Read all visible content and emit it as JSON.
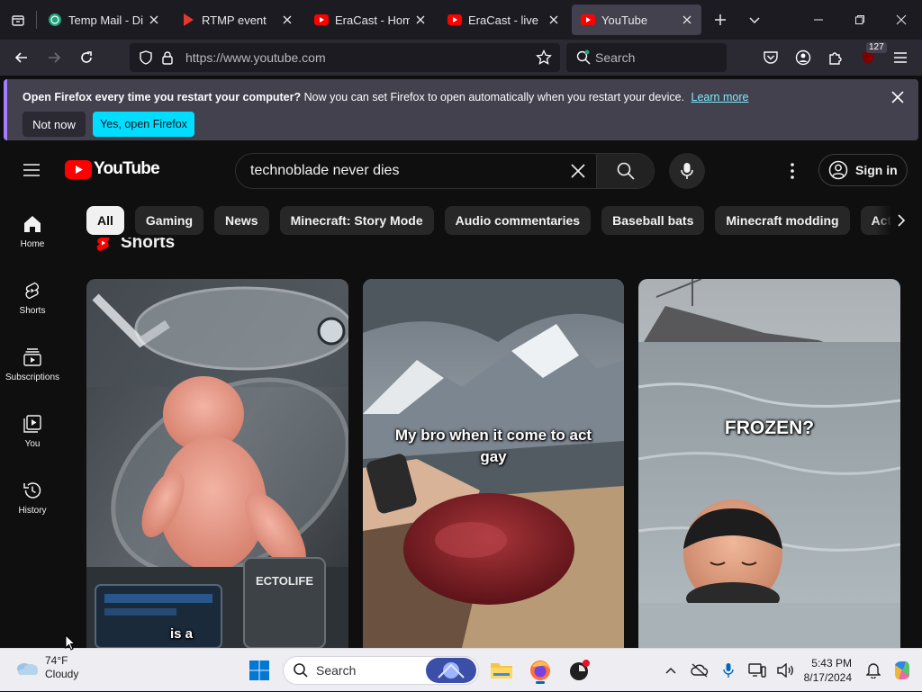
{
  "browser": {
    "tabs": [
      {
        "title": "Temp Mail - Disposable",
        "favicon": "tempmail-icon",
        "active": false
      },
      {
        "title": "RTMP event",
        "favicon": "play-triangle-icon",
        "active": false
      },
      {
        "title": "EraCast - Home",
        "favicon": "youtube-icon",
        "active": false
      },
      {
        "title": "EraCast - live",
        "favicon": "youtube-icon",
        "active": false
      },
      {
        "title": "YouTube",
        "favicon": "youtube-icon",
        "active": true
      }
    ],
    "url": "https://www.youtube.com",
    "search_placeholder": "Search",
    "extension_badge": "127",
    "colors": {
      "chrome_dark": "#1c1b22",
      "toolbar": "#2b2a33",
      "active_tab": "#42414d",
      "accent": "#00ddff"
    }
  },
  "notification": {
    "bold": "Open Firefox every time you restart your computer?",
    "text": "Now you can set Firefox to open automatically when you restart your device.",
    "link": "Learn more",
    "not_now": "Not now",
    "yes": "Yes, open Firefox"
  },
  "youtube": {
    "logo_text": "YouTube",
    "search_query": "technoblade never dies",
    "sign_in": "Sign in",
    "sidebar": [
      {
        "label": "Home",
        "icon": "home-icon"
      },
      {
        "label": "Shorts",
        "icon": "shorts-icon"
      },
      {
        "label": "Subscriptions",
        "icon": "subscriptions-icon"
      },
      {
        "label": "You",
        "icon": "you-icon"
      },
      {
        "label": "History",
        "icon": "history-icon"
      }
    ],
    "chips": [
      "All",
      "Gaming",
      "News",
      "Minecraft: Story Mode",
      "Audio commentaries",
      "Baseball bats",
      "Minecraft modding",
      "Acti"
    ],
    "shorts_title": "Shorts",
    "shorts": [
      {
        "caption": "is a",
        "scene": "baby in incubator pod",
        "pod_label": "ECTOLIFE"
      },
      {
        "caption": "My bro when it come to act gay",
        "scene": "meat on mountain"
      },
      {
        "caption": "FROZEN?",
        "scene": "man in icy water"
      }
    ],
    "colors": {
      "brand_red": "#ff0000",
      "bg": "#0f0f0f",
      "chip_bg": "#272727"
    }
  },
  "taskbar": {
    "temperature": "74°F",
    "condition": "Cloudy",
    "search_placeholder": "Search",
    "time": "5:43 PM",
    "date": "8/17/2024"
  }
}
